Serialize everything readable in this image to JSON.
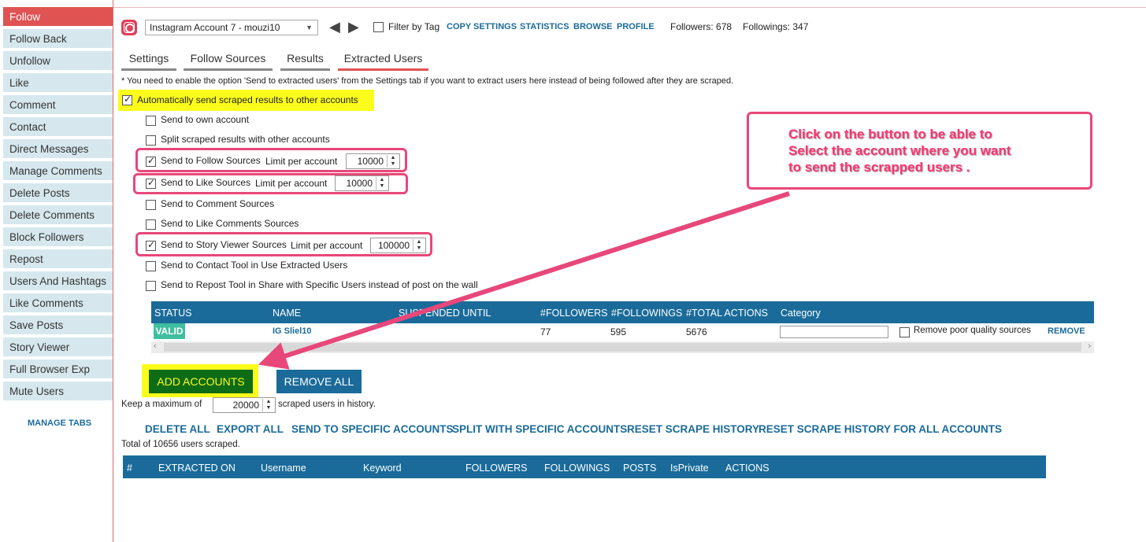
{
  "sidebar": {
    "items": [
      {
        "label": "Follow",
        "active": true
      },
      {
        "label": "Follow Back"
      },
      {
        "label": "Unfollow"
      },
      {
        "label": "Like"
      },
      {
        "label": "Comment"
      },
      {
        "label": "Contact"
      },
      {
        "label": "Direct Messages"
      },
      {
        "label": "Manage Comments"
      },
      {
        "label": "Delete Posts"
      },
      {
        "label": "Delete Comments"
      },
      {
        "label": "Block Followers"
      },
      {
        "label": "Repost"
      },
      {
        "label": "Users And Hashtags"
      },
      {
        "label": "Like Comments"
      },
      {
        "label": "Save Posts"
      },
      {
        "label": "Story Viewer"
      },
      {
        "label": "Full Browser Exp"
      },
      {
        "label": "Mute Users"
      }
    ],
    "manage_tabs": "MANAGE TABS"
  },
  "topbar": {
    "account": "Instagram Account 7 - mouzi10",
    "filter_label": "Filter by Tag",
    "links": [
      "COPY SETTINGS",
      "STATISTICS",
      "BROWSE",
      "PROFILE"
    ],
    "followers": "Followers: 678",
    "followings": "Followings: 347"
  },
  "tabs": [
    {
      "label": "Settings"
    },
    {
      "label": "Follow Sources"
    },
    {
      "label": "Results"
    },
    {
      "label": "Extracted Users",
      "active": true
    }
  ],
  "notice": "* You need to enable the option 'Send to extracted users' from the Settings tab if you want to extract users here instead of being followed after they are scraped.",
  "options": {
    "auto_send": {
      "label": "Automatically send scraped results to other accounts",
      "checked": true
    },
    "send_own": {
      "label": "Send to own account",
      "checked": false
    },
    "split": {
      "label": "Split scraped results with other accounts",
      "checked": false
    },
    "follow_sources": {
      "label": "Send to Follow Sources",
      "checked": true,
      "limit_label": "Limit per account",
      "limit": "10000"
    },
    "like_sources": {
      "label": "Send to Like Sources",
      "checked": true,
      "limit_label": "Limit per account",
      "limit": "10000"
    },
    "comment_sources": {
      "label": "Send to Comment Sources",
      "checked": false
    },
    "like_comments_sources": {
      "label": "Send to Like Comments Sources",
      "checked": false
    },
    "story_sources": {
      "label": "Send to Story Viewer Sources",
      "checked": true,
      "limit_label": "Limit per account",
      "limit": "100000"
    },
    "contact_tool": {
      "label": "Send to Contact Tool in Use Extracted Users",
      "checked": false
    },
    "repost_tool": {
      "label": "Send to Repost Tool in Share with Specific Users instead of post on the wall",
      "checked": false
    }
  },
  "accounts_table": {
    "headers": [
      "STATUS",
      "NAME",
      "SUSPENDED UNTIL",
      "#FOLLOWERS",
      "#FOLLOWINGS",
      "#TOTAL ACTIONS",
      "Category"
    ],
    "row": {
      "status": "VALID",
      "name": "IG Sliel10",
      "followers": "77",
      "followings": "595",
      "total_actions": "5676",
      "category": "",
      "remove_poor": "Remove poor quality sources",
      "remove": "REMOVE"
    }
  },
  "buttons": {
    "add_accounts": "ADD ACCOUNTS",
    "remove_all": "REMOVE ALL"
  },
  "history": {
    "prefix": "Keep a maximum of",
    "value": "20000",
    "suffix": "scraped users in history."
  },
  "actions": [
    "DELETE ALL",
    "EXPORT ALL",
    "SEND TO SPECIFIC ACCOUNTS",
    "SPLIT WITH SPECIFIC ACCOUNTS",
    "RESET SCRAPE HISTORY",
    "RESET SCRAPE HISTORY FOR ALL ACCOUNTS"
  ],
  "total": "Total of 10656 users scraped.",
  "results_table": {
    "headers": [
      "#",
      "EXTRACTED ON",
      "Username",
      "Keyword",
      "FOLLOWERS",
      "FOLLOWINGS",
      "POSTS",
      "IsPrivate",
      "ACTIONS"
    ]
  },
  "callout": {
    "text": "Click on the button to be able to\nSelect the account where you want\nto send the scrapped users ."
  },
  "colors": {
    "accent_red": "#e05353",
    "primary_blue": "#1a6b9a",
    "highlight_yellow": "#fcfc1c",
    "annotation_pink": "#e8477a",
    "valid_green": "#3fbfa0",
    "add_button_green": "#0e6b16"
  }
}
